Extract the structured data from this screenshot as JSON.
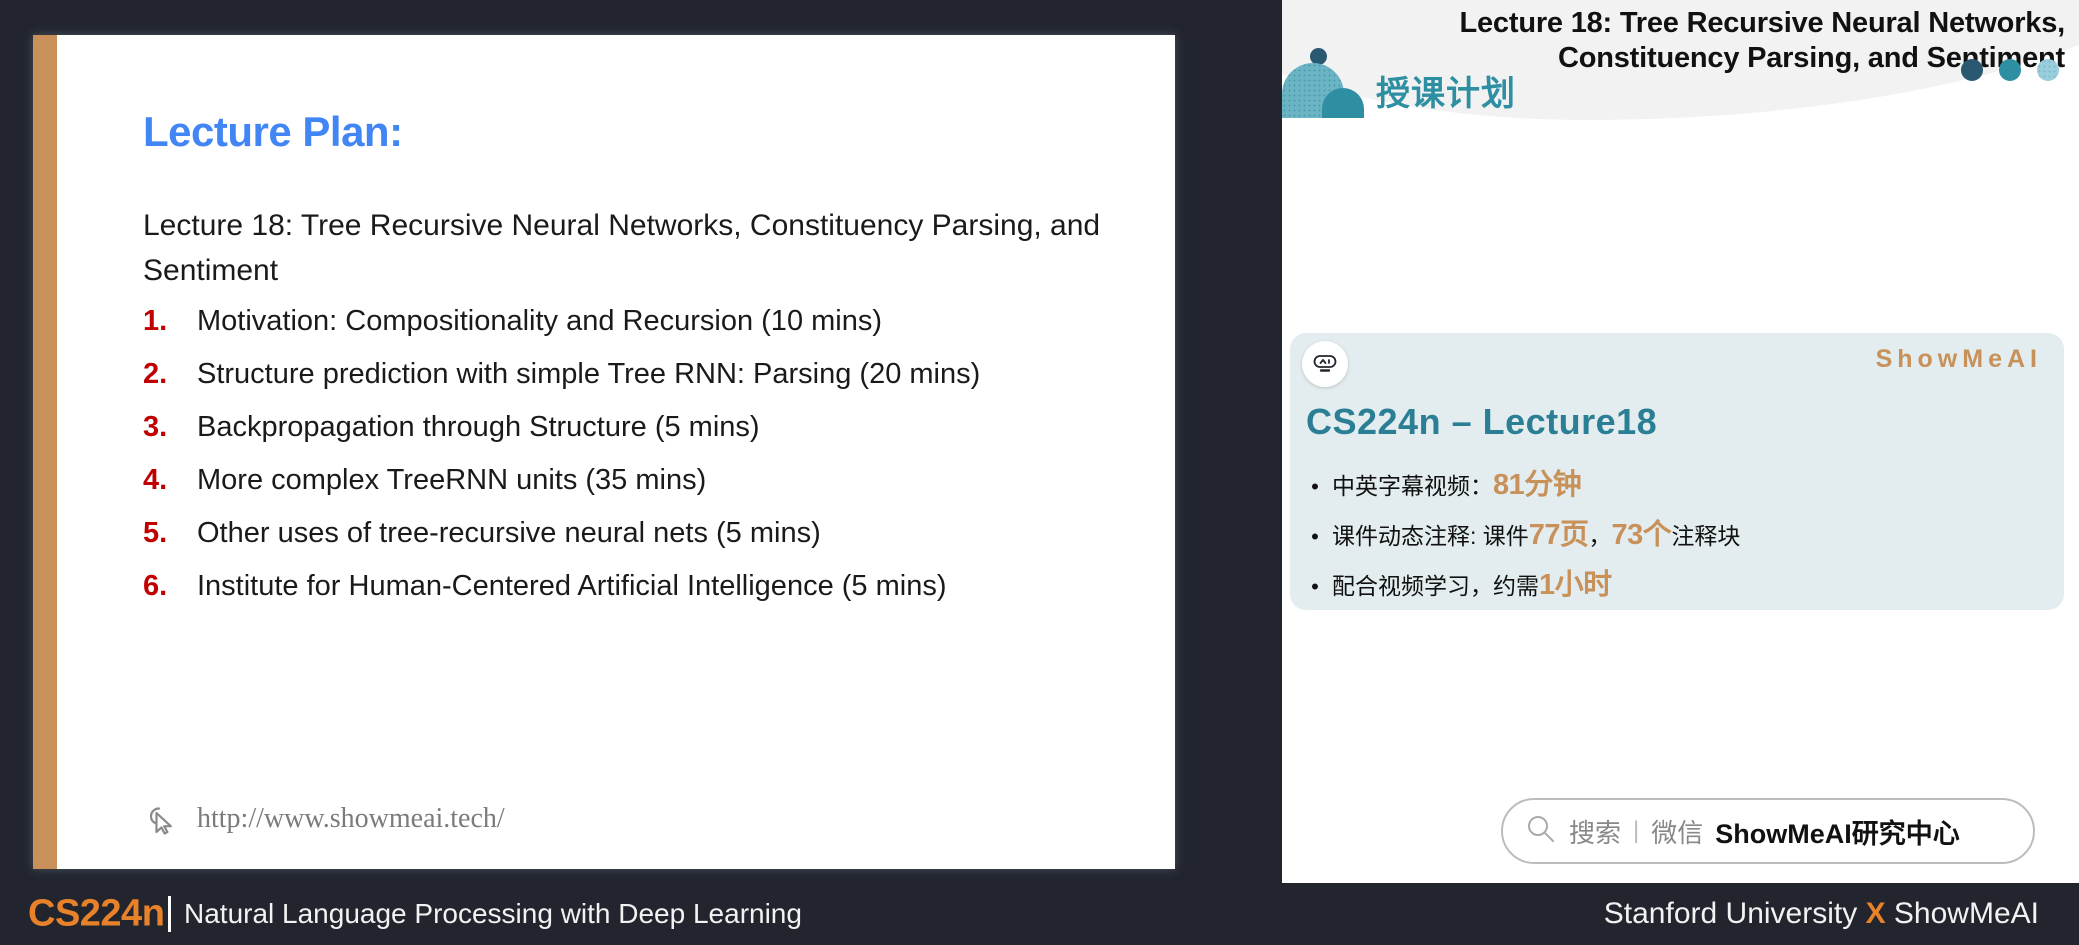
{
  "slide": {
    "title": "Lecture Plan:",
    "lead_paragraph": "Lecture 18: Tree Recursive Neural Networks, Constituency Parsing, and Sentiment",
    "list": [
      {
        "num": "1.",
        "text": "Motivation: Compositionality and Recursion (10 mins)"
      },
      {
        "num": "2.",
        "text": "Structure prediction with simple Tree RNN: Parsing (20 mins)"
      },
      {
        "num": "3.",
        "text": "Backpropagation through Structure (5 mins)"
      },
      {
        "num": "4.",
        "text": "More complex TreeRNN units (35 mins)"
      },
      {
        "num": "5.",
        "text": "Other uses of tree-recursive neural nets (5 mins)"
      },
      {
        "num": "6.",
        "text": "Institute for Human-Centered Artificial Intelligence (5 mins)"
      }
    ],
    "footer_url": "http://www.showmeai.tech/",
    "cursor_icon": "cursor-arrow-icon",
    "accent_bar_color": "#c8915a",
    "title_color": "#4285f4",
    "number_color": "#c00000"
  },
  "right_panel": {
    "header_title": "Lecture 18: Tree Recursive Neural Networks, Constituency Parsing, and Sentiment",
    "deco_title_cn": "授课计划",
    "dots": [
      {
        "name": "dot-dark",
        "color": "#2b5871"
      },
      {
        "name": "dot-medium",
        "color": "#2e8fa3"
      },
      {
        "name": "dot-light",
        "color": "#9bcedc"
      }
    ],
    "card": {
      "badge_icon": "robot-face-icon",
      "brand": "ShowMeAI",
      "brand_color": "#c8915a",
      "title": "CS224n – Lecture18",
      "title_color": "#2b7f95",
      "background": "#e3ecee",
      "bullets": [
        {
          "dot": "•",
          "parts": [
            {
              "text": "中英字幕视频：",
              "highlight": false
            },
            {
              "text": "81分钟",
              "highlight": true
            }
          ]
        },
        {
          "dot": "•",
          "parts": [
            {
              "text": "课件动态注释: 课件",
              "highlight": false
            },
            {
              "text": "77页",
              "highlight": true
            },
            {
              "text": "，",
              "highlight": false
            },
            {
              "text": "73个",
              "highlight": true
            },
            {
              "text": "注释块",
              "highlight": false
            }
          ]
        },
        {
          "dot": "•",
          "parts": [
            {
              "text": "配合视频学习，约需",
              "highlight": false
            },
            {
              "text": "1小时",
              "highlight": true
            }
          ]
        }
      ]
    },
    "search": {
      "icon": "search-icon",
      "label": "搜索",
      "separator": "|",
      "channel": "微信",
      "account": "ShowMeAI研究中心"
    }
  },
  "bottom_bar": {
    "course_code": "CS224n",
    "divider": "|",
    "course_name": "Natural Language Processing with Deep Learning",
    "credit_left": "Stanford University",
    "credit_x": "X",
    "credit_right": "ShowMeAI",
    "accent_color": "#e8822a",
    "background": "#22252e"
  }
}
